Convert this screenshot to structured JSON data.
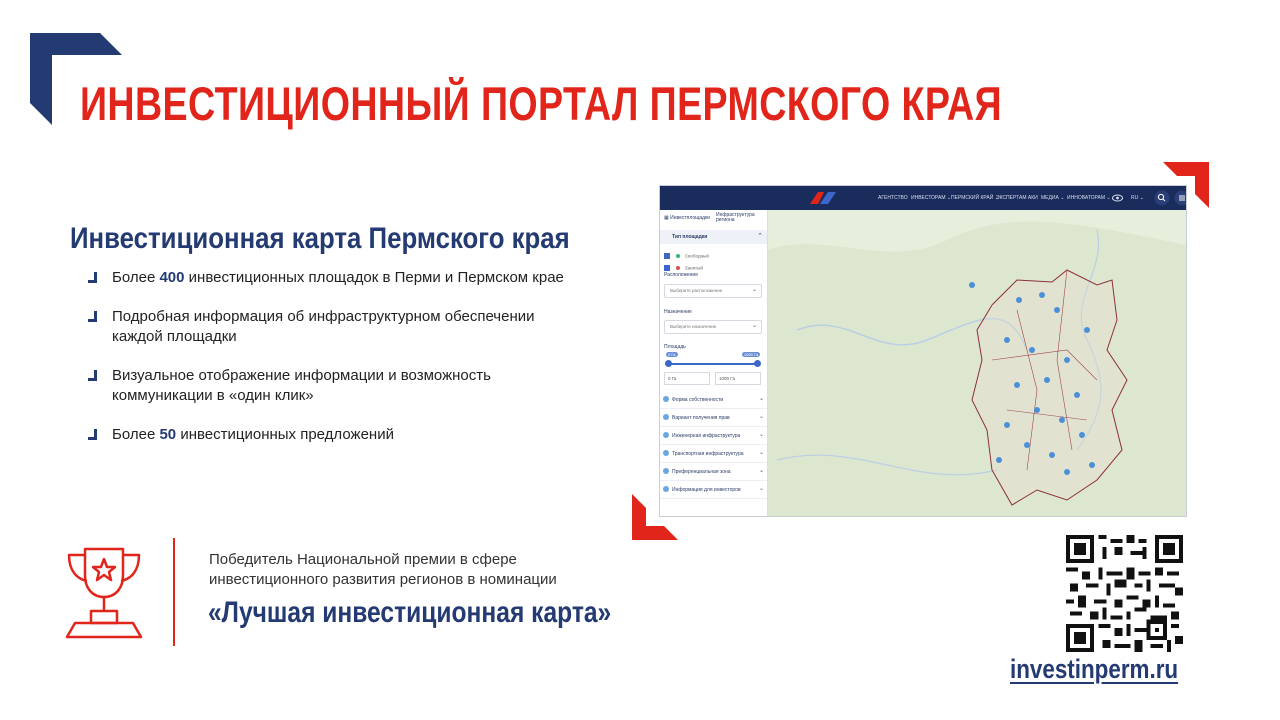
{
  "slide": {
    "title": "ИНВЕСТИЦИОННЫЙ ПОРТАЛ ПЕРМСКОГО КРАЯ",
    "section_title": "Инвестиционная карта Пермского края",
    "bullets": [
      {
        "pre": "Более ",
        "highlight": "400",
        "post": " инвестиционных площадок в Перми и Пермском крае"
      },
      {
        "pre": "Подробная информация об инфраструктурном обеспечении каждой площадки",
        "highlight": "",
        "post": ""
      },
      {
        "pre": "Визуальное отображение информации и возможность коммуникации в «один клик»",
        "highlight": "",
        "post": ""
      },
      {
        "pre": "Более ",
        "highlight": "50",
        "post": " инвестиционных предложений"
      }
    ],
    "award": {
      "text": "Победитель Национальной премии в сфере инвестиционного развития регионов в номинации",
      "name": "«Лучшая инвестиционная карта»"
    },
    "site_link": "investinperm.ru",
    "colors": {
      "accent_red": "#e1251b",
      "brand_navy": "#243a73",
      "topbar": "#1a2c5c"
    }
  },
  "map_screenshot": {
    "nav_items": [
      "АГЕНТСТВО",
      "ИНВЕСТОРАМ ⌄",
      "ПЕРМСКИЙ КРАЙ ⌄",
      "ЭКСПЕРТАМ АКИ",
      "МЕДИА ⌄",
      "ИННОВАТОРАМ ⌄",
      "RU ⌄"
    ],
    "tabs": [
      "Инвестплощадки",
      "Инфраструктура региона"
    ],
    "filter_header": "Тип площадки",
    "checkbox_items": [
      "Свободный",
      "Занятый"
    ],
    "location_label": "Расположение",
    "location_placeholder": "Выберите расположение",
    "name_label": "Назначение",
    "name_placeholder": "Выберите назначение",
    "area_label": "Площадь",
    "area_min_badge": "0 Га",
    "area_max_badge": "1000 Га",
    "area_min_value": "0 Га",
    "area_max_value": "1000 Га",
    "sections": [
      "Форма собственности",
      "Вариант получения прав",
      "Инженерная инфраструктура",
      "Транспортная инфраструктура",
      "Преференциальная зона",
      "Информация для инвесторов"
    ]
  }
}
